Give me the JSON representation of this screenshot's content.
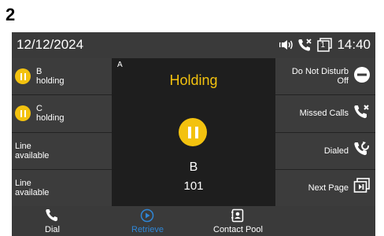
{
  "step_number": "2",
  "status_bar": {
    "date": "12/12/2024",
    "time": "14:40",
    "icons": [
      "speaker-icon",
      "missed-call-icon",
      "line-one-icon"
    ],
    "line_badge": "1"
  },
  "left_keys": [
    {
      "name": "B",
      "status": "holding",
      "icon": "hold-icon"
    },
    {
      "name": "C",
      "status": "holding",
      "icon": "hold-icon"
    },
    {
      "name": "Line",
      "status": "available"
    },
    {
      "name": "Line",
      "status": "available"
    }
  ],
  "right_keys": [
    {
      "label_line1": "Do Not Disturb",
      "label_line2": "Off",
      "icon": "dnd-icon"
    },
    {
      "label_line1": "Missed Calls",
      "icon": "missed-calls-icon"
    },
    {
      "label_line1": "Dialed",
      "icon": "dialed-icon"
    },
    {
      "label_line1": "Next Page",
      "icon": "next-page-icon"
    }
  ],
  "call": {
    "line_id": "A",
    "state": "Holding",
    "name": "B",
    "number": "101"
  },
  "softkeys": [
    {
      "label": "Dial",
      "icon": "handset-icon",
      "active": false
    },
    {
      "label": "Retrieve",
      "icon": "play-icon",
      "active": true
    },
    {
      "label": "Contact Pool",
      "icon": "contacts-icon",
      "active": false
    }
  ],
  "colors": {
    "accent_yellow": "#f3c20f",
    "active_blue": "#2f86d6",
    "screen_bg": "#2c2c2c"
  }
}
